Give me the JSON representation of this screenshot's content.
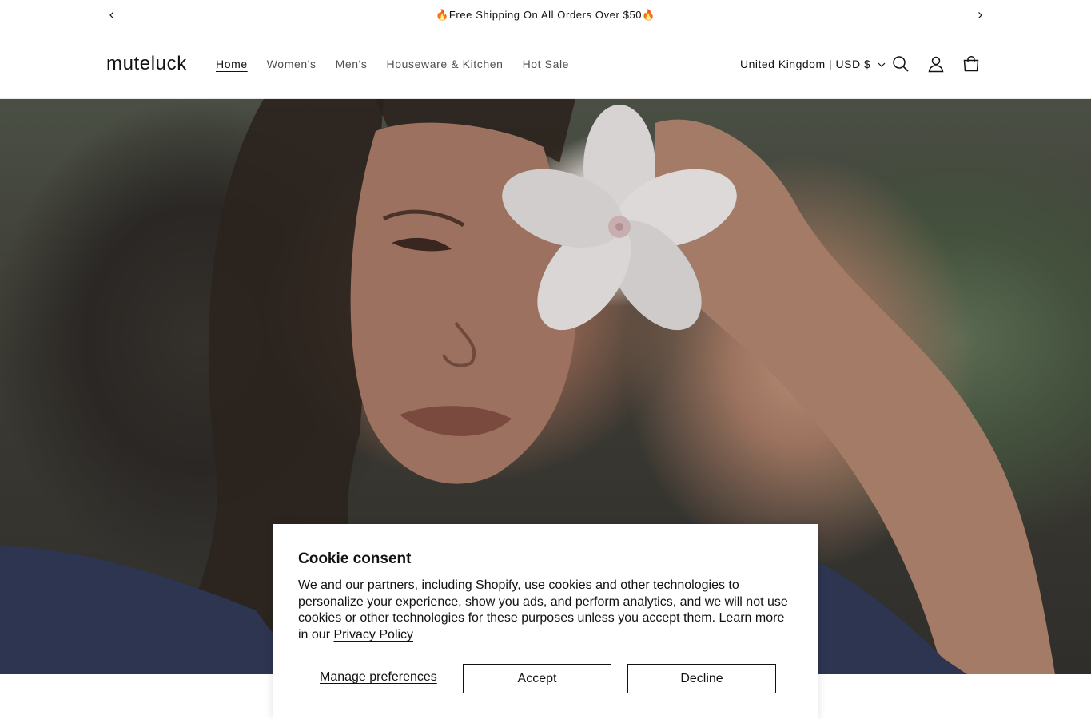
{
  "announcement": {
    "text": "🔥Free Shipping On All Orders Over $50🔥",
    "prev_icon": "chevron-left-icon",
    "next_icon": "chevron-right-icon"
  },
  "header": {
    "logo": "muteluck",
    "nav": [
      {
        "label": "Home",
        "active": true
      },
      {
        "label": "Women's",
        "active": false
      },
      {
        "label": "Men's",
        "active": false
      },
      {
        "label": "Houseware & Kitchen",
        "active": false
      },
      {
        "label": "Hot Sale",
        "active": false
      }
    ],
    "locale": "United Kingdom | USD $",
    "icons": [
      "search-icon",
      "account-icon",
      "cart-icon"
    ]
  },
  "hero": {
    "image_subject": "woman holding white flower over eye"
  },
  "cookie": {
    "title": "Cookie consent",
    "body": "We and our partners, including Shopify, use cookies and other technologies to personalize your experience, show you ads, and perform analytics, and we will not use cookies or other technologies for these purposes unless you accept them. Learn more in our ",
    "privacy_link": "Privacy Policy",
    "manage": "Manage preferences",
    "accept": "Accept",
    "decline": "Decline"
  },
  "colors": {
    "text": "#121212",
    "border": "#e6e6e6",
    "background": "#ffffff"
  }
}
